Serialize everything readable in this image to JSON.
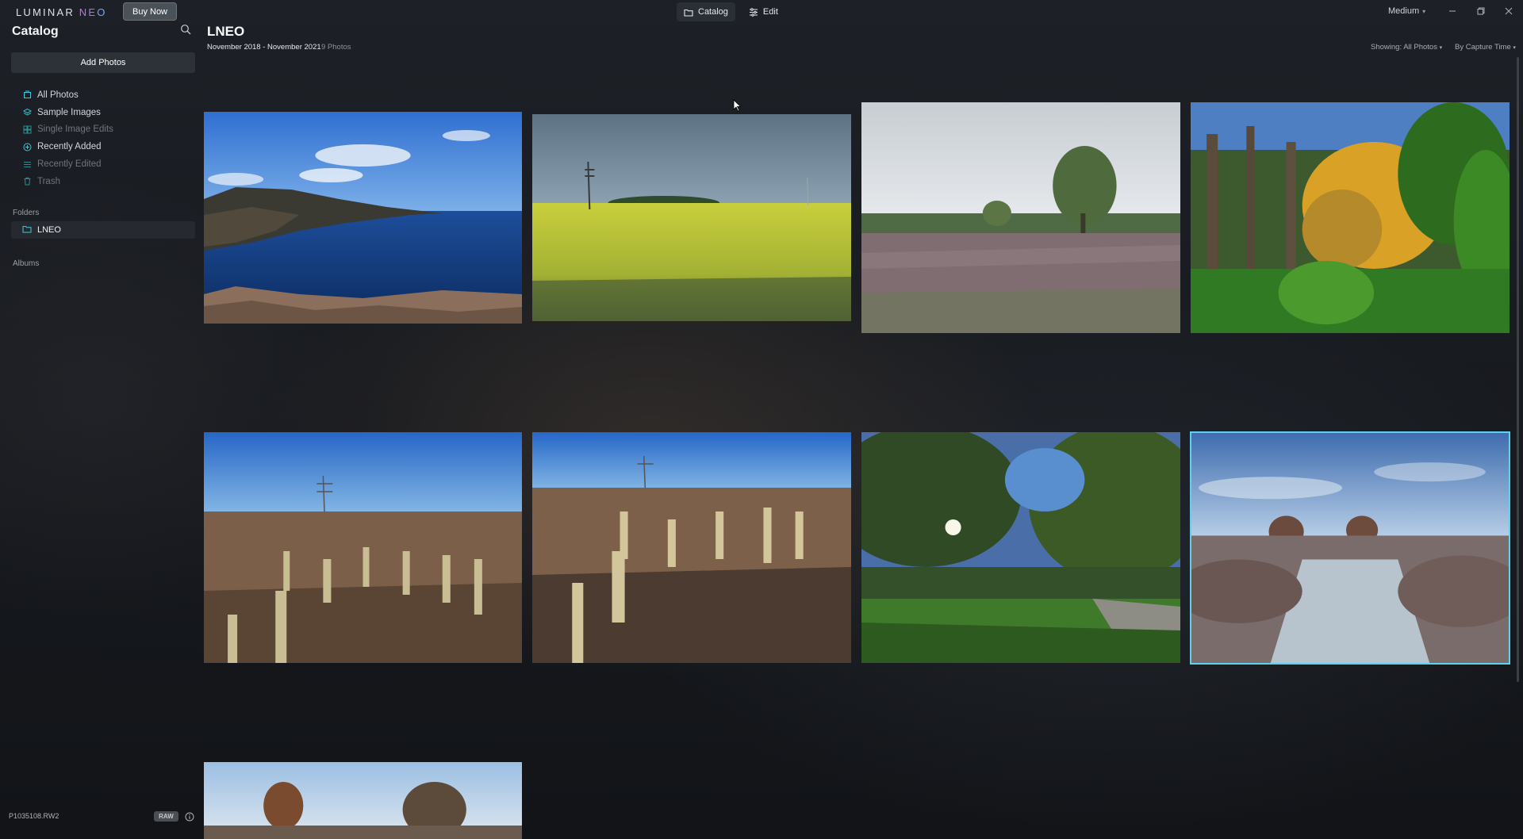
{
  "app": {
    "logo_text": "LUMINAR",
    "logo_accent": "NEO",
    "buy_label": "Buy Now",
    "tabs": [
      {
        "label": "Catalog",
        "icon": "folder-icon",
        "active": true
      },
      {
        "label": "Edit",
        "icon": "sliders-icon",
        "active": false
      }
    ],
    "zoom_label": "Medium",
    "chevron": "▾"
  },
  "sidebar": {
    "title": "Catalog",
    "add_label": "Add Photos",
    "items": [
      {
        "label": "All Photos",
        "icon": "photos-icon",
        "enabled": true
      },
      {
        "label": "Sample Images",
        "icon": "layers-icon",
        "enabled": true
      },
      {
        "label": "Single Image Edits",
        "icon": "grid-icon",
        "enabled": false
      },
      {
        "label": "Recently Added",
        "icon": "plus-circle-icon",
        "enabled": true
      },
      {
        "label": "Recently Edited",
        "icon": "sliders-icon",
        "enabled": false
      },
      {
        "label": "Trash",
        "icon": "trash-icon",
        "enabled": false
      }
    ],
    "folders_label": "Folders",
    "folder_name": "LNEO",
    "albums_label": "Albums",
    "file_name": "P1035108.RW2",
    "raw_label": "RAW"
  },
  "main": {
    "title": "LNEO",
    "date_range": "November 2018 - November 2021",
    "count": "9 Photos",
    "showing": "Showing: All Photos",
    "sort": "By Capture Time"
  },
  "photos": [
    {
      "name": "coastal-cliffs-photo",
      "selected": false
    },
    {
      "name": "rapeseed-field-photo",
      "selected": false
    },
    {
      "name": "heathland-tree-photo",
      "selected": false
    },
    {
      "name": "autumn-forest-photo",
      "selected": false
    },
    {
      "name": "stubble-field-photo",
      "selected": false
    },
    {
      "name": "stubble-field-closeup-photo",
      "selected": false
    },
    {
      "name": "sunlit-trees-photo",
      "selected": false
    },
    {
      "name": "frosty-heath-photo",
      "selected": true
    },
    {
      "name": "autumn-trees-sky-photo",
      "selected": false
    }
  ],
  "colors": {
    "accent": "#5fd1ec",
    "sidebar_icon": "#3ec9d8",
    "background": "#181b20"
  }
}
